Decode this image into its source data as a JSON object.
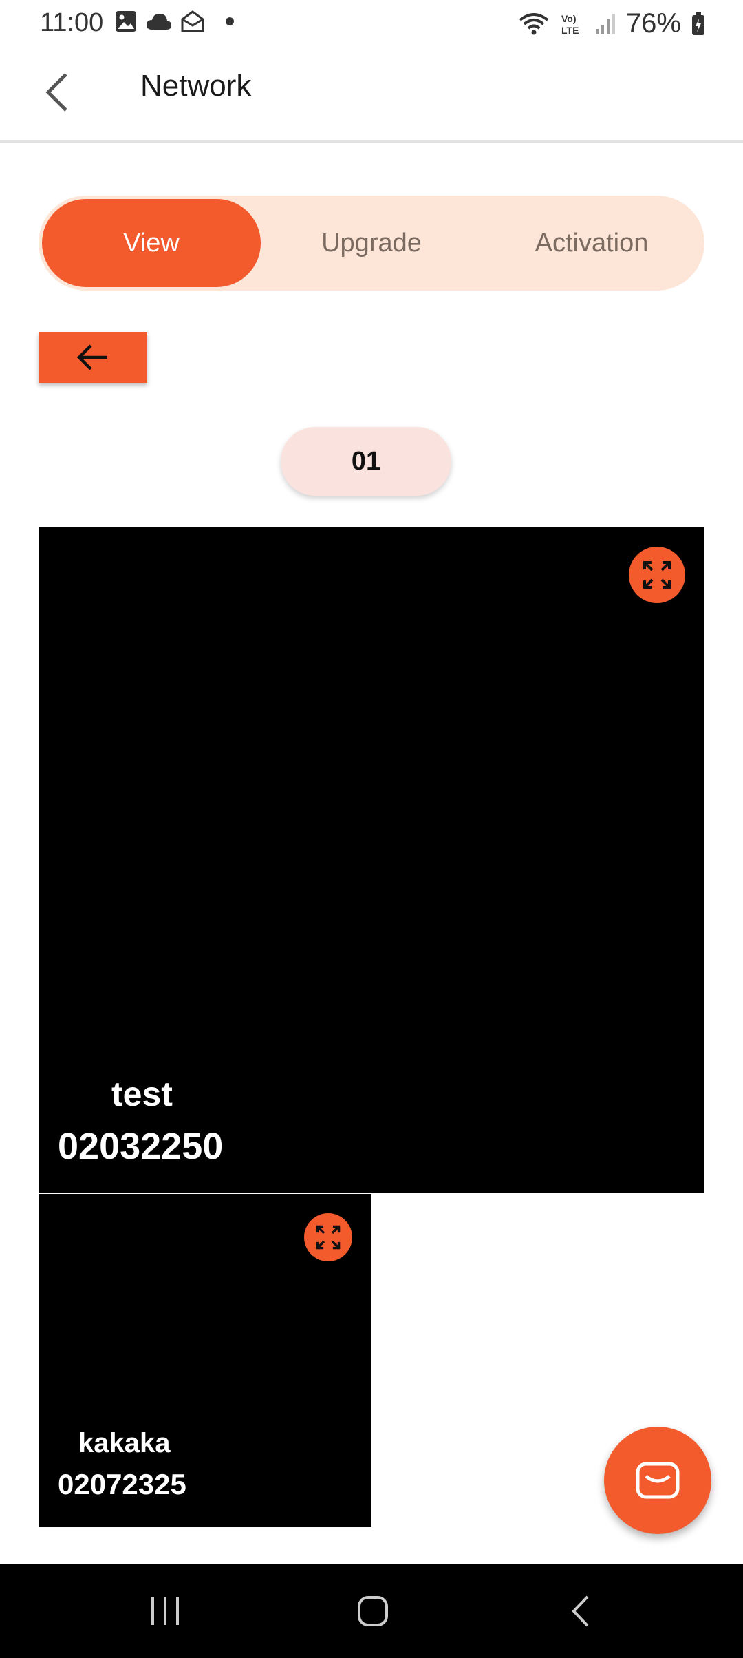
{
  "status_bar": {
    "time": "11:00",
    "battery": "76%",
    "left_icons": [
      "image-icon",
      "cloud-icon",
      "mail-open-icon",
      "dot-icon"
    ],
    "right_icons": [
      "wifi-icon",
      "volte-icon",
      "signal-icon",
      "battery-icon"
    ]
  },
  "header": {
    "title": "Network",
    "back_icon": "chevron-left-icon"
  },
  "tabs": [
    {
      "label": "View",
      "active": true
    },
    {
      "label": "Upgrade",
      "active": false
    },
    {
      "label": "Activation",
      "active": false
    }
  ],
  "back_button_icon": "arrow-left-icon",
  "page_indicator": "01",
  "tiles": [
    {
      "name": "test",
      "number": "02032250",
      "expand_icon": "expand-icon"
    },
    {
      "name": "kakaka",
      "number": "02072325",
      "expand_icon": "expand-icon"
    }
  ],
  "fab_icon": "message-icon",
  "colors": {
    "accent": "#f35a2c",
    "segment_bg": "#fde6d8",
    "pill_bg": "#fae3de",
    "tile_bg": "#000000"
  }
}
